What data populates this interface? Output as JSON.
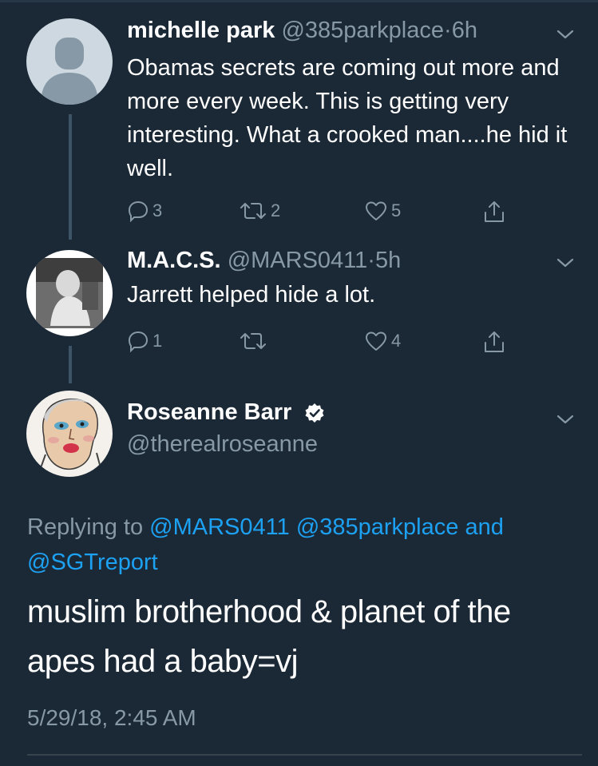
{
  "tweets": [
    {
      "name": "michelle park",
      "handle": "@385parkplace",
      "dot": "·",
      "time": "6h",
      "text": "Obamas secrets are coming out more and more every week. This is getting very interesting.  What a crooked man....he hid it well.",
      "replies": "3",
      "retweets": "2",
      "likes": "5"
    },
    {
      "name": "M.A.C.S.",
      "handle": "@MARS0411",
      "dot": "·",
      "time": "5h",
      "text": "Jarrett helped hide a lot.",
      "replies": "1",
      "retweets": "",
      "likes": "4"
    }
  ],
  "main": {
    "name": "Roseanne Barr",
    "handle": "@therealroseanne",
    "replying_prefix": "Replying to",
    "mention1": "@MARS0411",
    "mention2": "@385parkplace",
    "and_label": "and",
    "mention3": "@SGTreport",
    "text": "muslim brotherhood & planet of the apes had a baby=vj",
    "timestamp": "5/29/18, 2:45 AM"
  },
  "colors": {
    "background": "#1b2836",
    "secondary_text": "#8899a6",
    "accent": "#1da1f2"
  }
}
